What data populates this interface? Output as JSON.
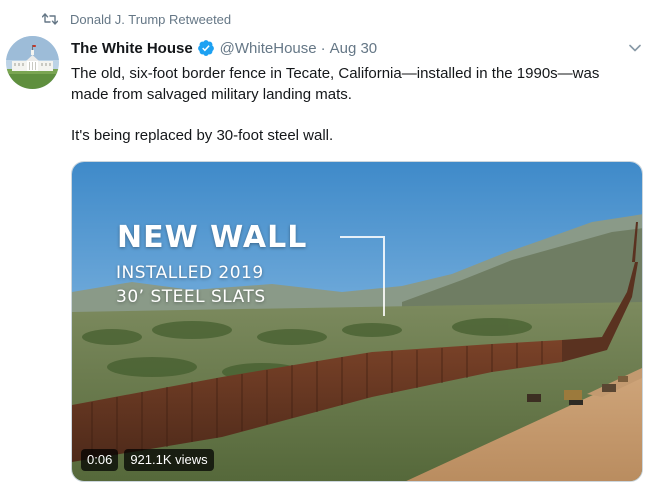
{
  "retweet": {
    "icon": "retweet-icon",
    "label": "Donald J. Trump Retweeted"
  },
  "author": {
    "name": "The White House",
    "verified": true,
    "handle": "@WhiteHouse",
    "separator": "·",
    "date": "Aug 30",
    "avatar_icon": "white-house-avatar"
  },
  "tweet": {
    "paragraphs": [
      "The old, six-foot border fence in Tecate, California—installed in the 1990s—was made from salvaged military landing mats.",
      "It's being replaced by 30-foot steel wall."
    ]
  },
  "video": {
    "overlay_title": "NEW WALL",
    "overlay_line1": "INSTALLED 2019",
    "overlay_line2": "30’ STEEL SLATS",
    "duration": "0:06",
    "views": "921.1K views"
  },
  "colors": {
    "text": "#14171a",
    "secondary": "#657786",
    "verified": "#1da1f2"
  }
}
